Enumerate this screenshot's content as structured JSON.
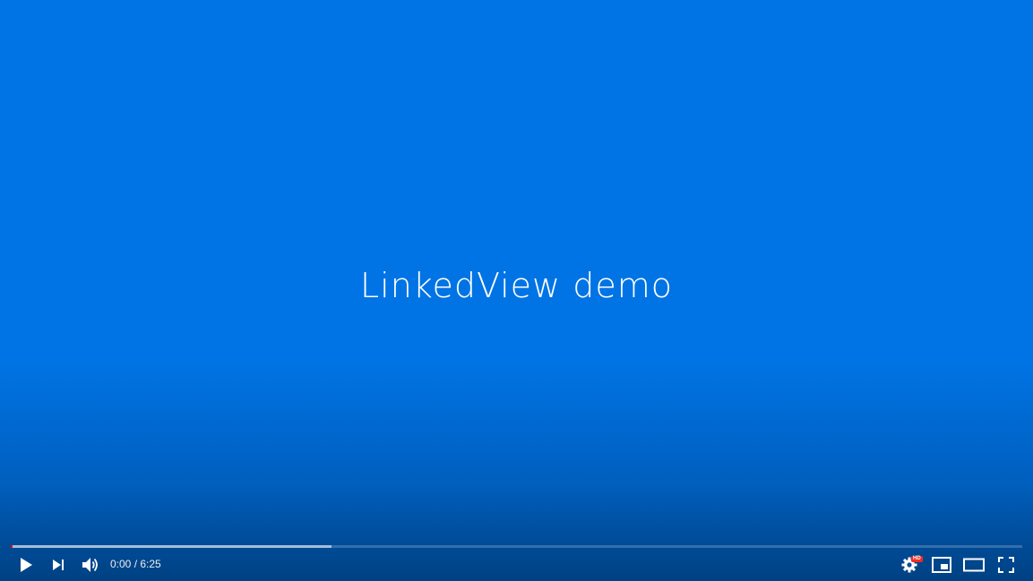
{
  "video": {
    "title_card": "LinkedView demo",
    "background_color": "#0074e4"
  },
  "progress": {
    "played_fraction": 0.002,
    "buffered_fraction": 0.317,
    "played_color": "#ff0000"
  },
  "controls": {
    "current_time": "0:00",
    "separator": " / ",
    "duration": "6:25",
    "quality_badge": "HD",
    "icons": {
      "play": "play-icon",
      "next": "next-icon",
      "volume": "volume-icon",
      "settings": "gear-icon",
      "miniplayer": "miniplayer-icon",
      "theater": "theater-mode-icon",
      "fullscreen": "fullscreen-icon"
    }
  }
}
